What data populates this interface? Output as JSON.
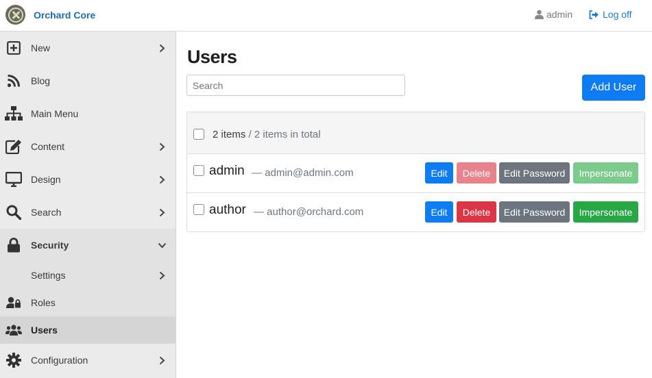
{
  "header": {
    "brand": "Orchard Core",
    "user": "admin",
    "logoff": "Log off"
  },
  "sidebar": {
    "items": [
      {
        "label": "New",
        "icon": "plus-square-icon"
      },
      {
        "label": "Blog",
        "icon": "rss-icon"
      },
      {
        "label": "Main Menu",
        "icon": "sitemap-icon"
      },
      {
        "label": "Content",
        "icon": "edit-icon"
      },
      {
        "label": "Design",
        "icon": "desktop-icon"
      },
      {
        "label": "Search",
        "icon": "search-icon"
      },
      {
        "label": "Security",
        "icon": "lock-icon"
      },
      {
        "label": "Settings",
        "icon": ""
      },
      {
        "label": "Roles",
        "icon": "user-lock-icon"
      },
      {
        "label": "Users",
        "icon": "users-icon"
      },
      {
        "label": "Configuration",
        "icon": "cog-icon"
      }
    ]
  },
  "main": {
    "title": "Users",
    "search_placeholder": "Search",
    "add_user": "Add User",
    "summary_count": "2 items",
    "summary_total": " / 2 items in total",
    "buttons": {
      "edit": "Edit",
      "delete": "Delete",
      "edit_password": "Edit Password",
      "impersonate": "Impersonate"
    },
    "users": [
      {
        "name": "admin",
        "email": "— admin@admin.com",
        "actions_disabled": true
      },
      {
        "name": "author",
        "email": "— author@orchard.com",
        "actions_disabled": false
      }
    ]
  },
  "colors": {
    "primary": "#0d7cf2",
    "danger": "#dc3545",
    "secondary": "#6c757d",
    "success": "#28a745",
    "brand": "#1a6bb0"
  }
}
